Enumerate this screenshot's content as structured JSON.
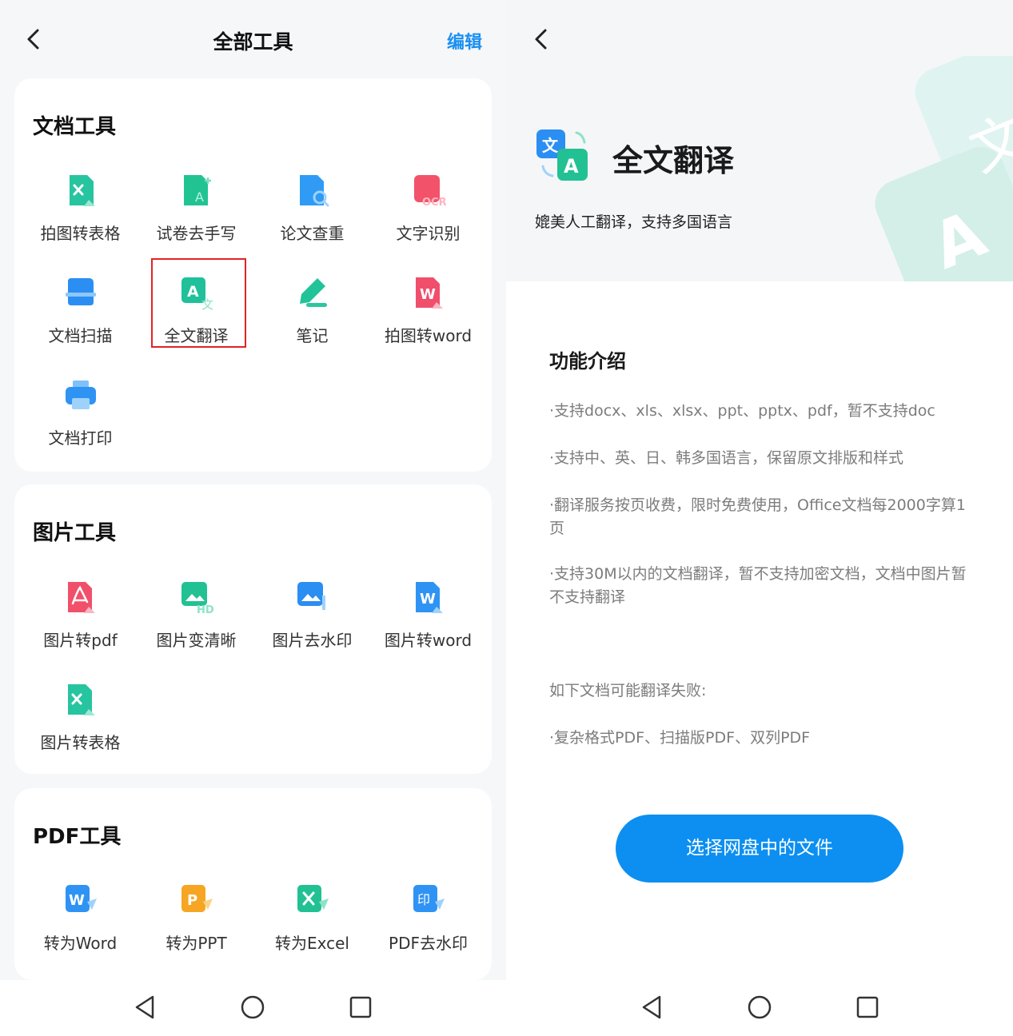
{
  "left": {
    "back_icon": "chevron-left-icon",
    "title": "全部工具",
    "edit_label": "编辑",
    "sections": [
      {
        "title": "文档工具",
        "tools": [
          {
            "label": "拍图转表格",
            "icon": "photo-to-table-icon"
          },
          {
            "label": "试卷去手写",
            "icon": "remove-handwriting-icon"
          },
          {
            "label": "论文查重",
            "icon": "plagiarism-check-icon"
          },
          {
            "label": "文字识别",
            "icon": "ocr-icon"
          },
          {
            "label": "文档扫描",
            "icon": "document-scan-icon"
          },
          {
            "label": "全文翻译",
            "icon": "translate-icon",
            "highlighted": true
          },
          {
            "label": "笔记",
            "icon": "note-pen-icon"
          },
          {
            "label": "拍图转word",
            "icon": "photo-to-word-icon"
          },
          {
            "label": "文档打印",
            "icon": "printer-icon"
          }
        ]
      },
      {
        "title": "图片工具",
        "tools": [
          {
            "label": "图片转pdf",
            "icon": "image-to-pdf-icon"
          },
          {
            "label": "图片变清晰",
            "icon": "image-hd-icon"
          },
          {
            "label": "图片去水印",
            "icon": "image-remove-watermark-icon"
          },
          {
            "label": "图片转word",
            "icon": "image-to-word-icon"
          },
          {
            "label": "图片转表格",
            "icon": "image-to-table-icon"
          }
        ]
      },
      {
        "title": "PDF工具",
        "tools": [
          {
            "label": "转为Word",
            "icon": "pdf-to-word-icon"
          },
          {
            "label": "转为PPT",
            "icon": "pdf-to-ppt-icon"
          },
          {
            "label": "转为Excel",
            "icon": "pdf-to-excel-icon"
          },
          {
            "label": "PDF去水印",
            "icon": "pdf-remove-watermark-icon"
          }
        ]
      }
    ]
  },
  "right": {
    "back_icon": "chevron-left-icon",
    "title": "全文翻译",
    "subtitle": "媲美人工翻译，支持多国语言",
    "section_title": "功能介绍",
    "features": [
      "·支持docx、xls、xlsx、ppt、pptx、pdf，暂不支持doc",
      "·支持中、英、日、韩多国语言，保留原文排版和样式",
      "·翻译服务按页收费，限时免费使用，Office文档每2000字算1页",
      "·支持30M以内的文档翻译，暂不支持加密文档，文档中图片暂不支持翻译"
    ],
    "failure_title": "如下文档可能翻译失败:",
    "failure_item": "·复杂格式PDF、扫描版PDF、双列PDF",
    "cta_label": "选择网盘中的文件",
    "colors": {
      "accent": "#0c8ff1",
      "edit": "#1a8ff0",
      "highlight_border": "#e02424"
    }
  },
  "navbar": {
    "icons": [
      "back-triangle-icon",
      "home-circle-icon",
      "recents-square-icon"
    ]
  }
}
